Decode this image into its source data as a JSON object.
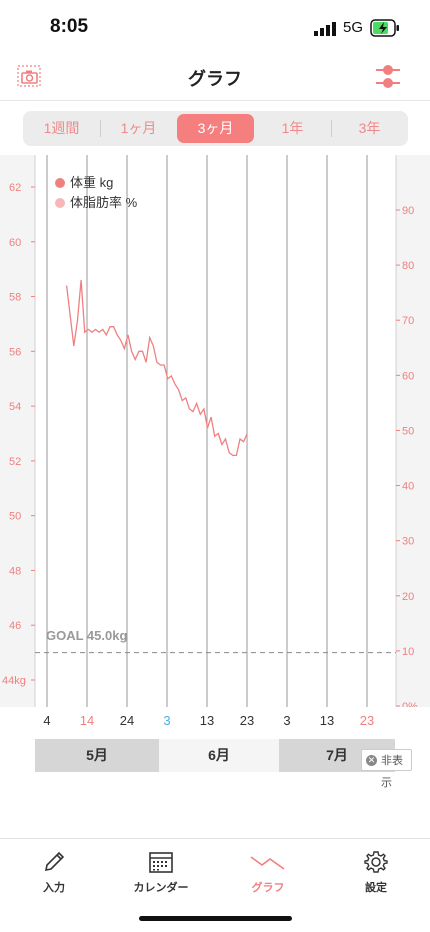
{
  "status": {
    "time": "8:05",
    "network": "5G"
  },
  "nav": {
    "title": "グラフ",
    "camera_icon": "camera-icon",
    "filter_icon": "filter-icon"
  },
  "segments": [
    {
      "label": "1週間",
      "active": false
    },
    {
      "label": "1ヶ月",
      "active": false
    },
    {
      "label": "3ヶ月",
      "active": true
    },
    {
      "label": "1年",
      "active": false
    },
    {
      "label": "3年",
      "active": false
    }
  ],
  "colors": {
    "accent": "#f57e7e",
    "weight_line": "#f08080",
    "fat_dot": "#f7b7b7",
    "blue": "#4ab0e0",
    "goal": "#8a8a8a"
  },
  "legend": {
    "weight": "体重 kg",
    "fat": "体脂肪率 %"
  },
  "goal_label": "GOAL 45.0kg",
  "chart_data": {
    "type": "line",
    "y_left": {
      "ticks": [
        "62",
        "60",
        "58",
        "56",
        "54",
        "52",
        "50",
        "48",
        "46",
        "44kg"
      ],
      "range": [
        44,
        62
      ]
    },
    "y_right": {
      "ticks": [
        "90",
        "80",
        "70",
        "60",
        "50",
        "40",
        "30",
        "20",
        "10",
        "0%"
      ],
      "range": [
        0,
        90
      ]
    },
    "x_ticks": [
      {
        "label": "4",
        "color": "#333333"
      },
      {
        "label": "14",
        "color": "#f08080"
      },
      {
        "label": "24",
        "color": "#333333"
      },
      {
        "label": "3",
        "color": "#4ab0e0"
      },
      {
        "label": "13",
        "color": "#333333"
      },
      {
        "label": "23",
        "color": "#333333"
      },
      {
        "label": "3",
        "color": "#333333"
      },
      {
        "label": "13",
        "color": "#333333"
      },
      {
        "label": "23",
        "color": "#f08080"
      }
    ],
    "goal": 45.0,
    "series": [
      {
        "name": "体重 kg",
        "x": [
          0.4,
          0.8,
          1.2,
          1.6,
          2.0,
          2.4,
          2.8,
          3.2,
          3.6,
          4.0,
          4.4,
          4.8,
          5.2,
          5.6,
          6.0,
          6.4,
          6.8,
          7.2,
          7.6,
          8.0,
          8.4,
          8.8,
          9.2,
          9.6,
          10.0,
          10.4,
          10.8,
          11.2,
          11.6,
          12.0,
          12.4,
          12.8,
          13.2,
          13.6,
          14.0,
          14.4,
          14.8,
          15.2,
          15.6,
          16.0,
          16.4,
          16.8,
          17.2,
          17.6,
          18.0,
          18.4,
          18.8,
          19.2,
          19.6,
          20.0,
          20.4
        ],
        "values": [
          58.4,
          57.3,
          56.2,
          57.1,
          58.6,
          56.7,
          56.8,
          56.7,
          56.8,
          56.7,
          56.8,
          56.6,
          56.9,
          56.9,
          56.6,
          56.4,
          56.1,
          56.6,
          56.0,
          55.7,
          56.0,
          56.0,
          55.6,
          56.5,
          56.2,
          55.6,
          55.5,
          55.5,
          55.0,
          55.1,
          54.8,
          54.6,
          54.2,
          54.3,
          53.9,
          53.8,
          54.1,
          53.7,
          53.9,
          53.2,
          53.6,
          52.9,
          53.0,
          52.6,
          52.8,
          52.3,
          52.2,
          52.2,
          52.8,
          52.7,
          53.0
        ]
      }
    ],
    "months": [
      "5月",
      "6月",
      "7月"
    ]
  },
  "hide_button": "非表示",
  "tabs": [
    {
      "label": "入力",
      "icon": "pencil-icon",
      "active": false
    },
    {
      "label": "カレンダー",
      "icon": "calendar-icon",
      "active": false
    },
    {
      "label": "グラフ",
      "icon": "graph-icon",
      "active": true
    },
    {
      "label": "設定",
      "icon": "gear-icon",
      "active": false
    }
  ]
}
